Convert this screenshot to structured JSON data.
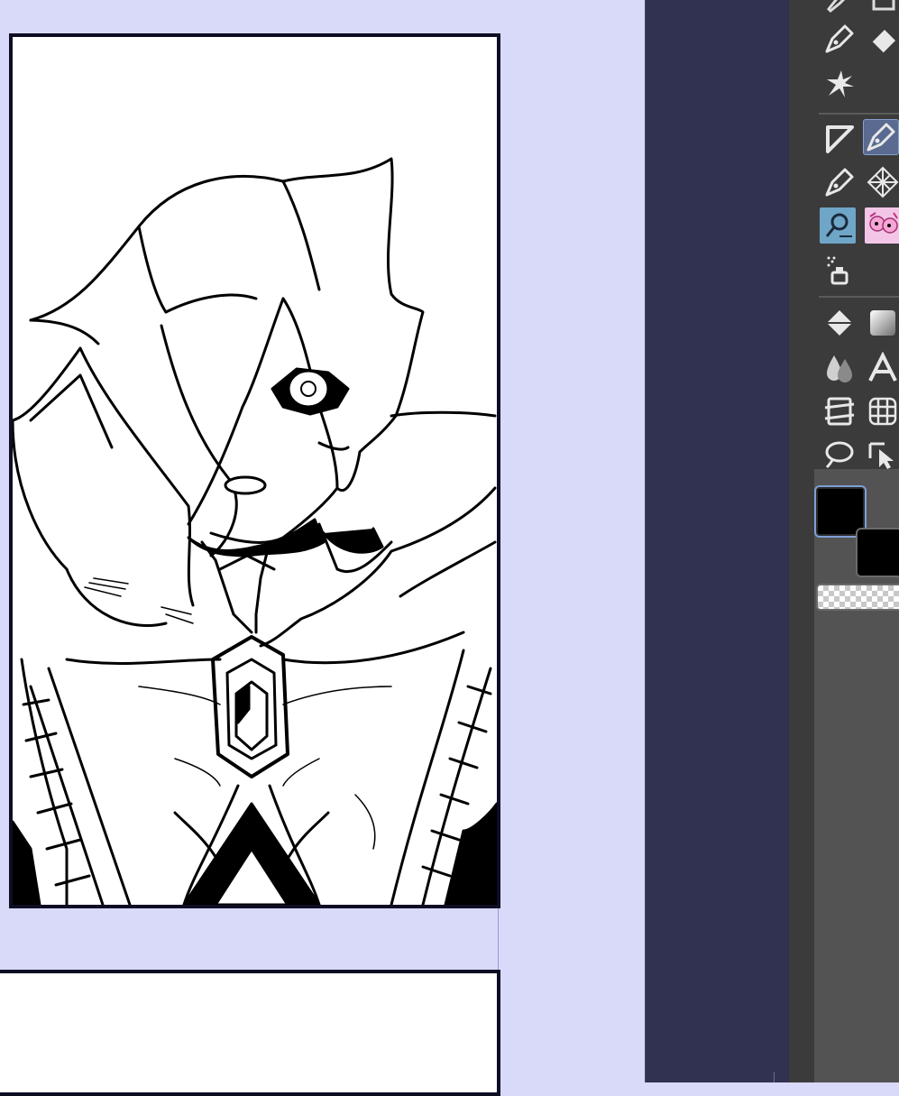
{
  "canvas": {
    "background_color": "#d9d9fa",
    "frame_border_color": "#0d0d24",
    "panels": [
      "main-panel",
      "lower-panel"
    ]
  },
  "side_panel": {
    "color": "#313152"
  },
  "toolbar": {
    "background_color": "#3b3b3b",
    "active_tool": "figure-pen-tool",
    "groups": [
      {
        "name": "drawing",
        "tools": [
          "pen-tool",
          "eraser-tool",
          "sparkle-tool"
        ]
      },
      {
        "name": "figure",
        "tools": [
          "ruler-tool",
          "figure-pen-tool",
          "ink-pen-tool",
          "screentone-tool",
          "decoration-tool",
          "material-tool",
          "airbrush-tool"
        ]
      },
      {
        "name": "editing",
        "tools": [
          "fill-tool",
          "gradient-tool",
          "blend-tool",
          "text-tool",
          "frame-tool",
          "grid-tool",
          "lasso-tool",
          "object-select-tool"
        ]
      }
    ]
  },
  "colors": {
    "main_color": "#000000",
    "sub_color": "#000000",
    "transparent": true
  }
}
